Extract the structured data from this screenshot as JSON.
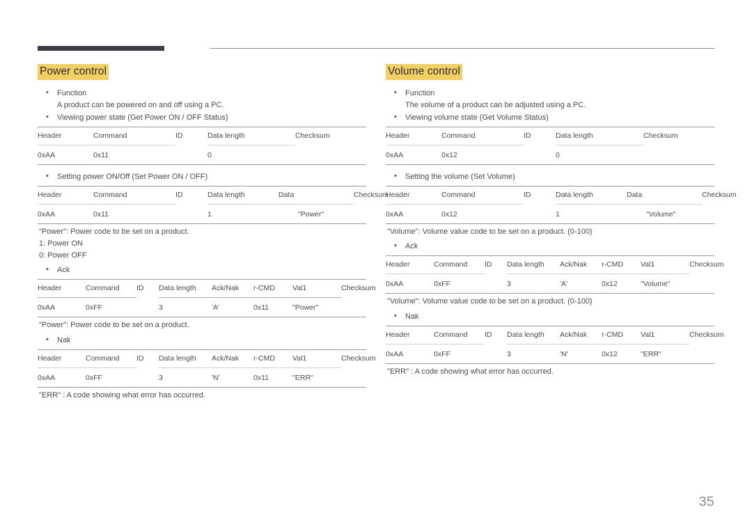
{
  "page": {
    "number": "35"
  },
  "sections": [
    {
      "id": "power-control",
      "title": "Power control",
      "function_label": "Function",
      "function_text": "A product can be powered on and off using a PC.",
      "get_label": "Viewing power state (Get Power ON / OFF Status)",
      "get_table": {
        "headers": [
          "Header",
          "Command",
          "ID",
          "Data length",
          "Checksum"
        ],
        "row": [
          "0xAA",
          "0x11",
          "",
          "0",
          ""
        ]
      },
      "set_label": "Setting power ON/Off (Set Power ON / OFF)",
      "set_table": {
        "headers": [
          "Header",
          "Command",
          "ID",
          "Data length",
          "Data",
          "Checksum"
        ],
        "row": [
          "0xAA",
          "0x11",
          "",
          "1",
          "\"Power\"",
          ""
        ]
      },
      "set_note": "\"Power\": Power code to be set on a product.",
      "set_note_lines": [
        "1: Power ON",
        "0: Power OFF"
      ],
      "ack_label": "Ack",
      "ack_table": {
        "headers": [
          "Header",
          "Command",
          "ID",
          "Data length",
          "Ack/Nak",
          "r-CMD",
          "Val1",
          "Checksum"
        ],
        "row": [
          "0xAA",
          "0xFF",
          "",
          "3",
          "'A'",
          "0x11",
          "\"Power\"",
          ""
        ]
      },
      "ack_note": "\"Power\": Power code to be set on a product.",
      "nak_label": "Nak",
      "nak_table": {
        "headers": [
          "Header",
          "Command",
          "ID",
          "Data length",
          "Ack/Nak",
          "r-CMD",
          "Val1",
          "Checksum"
        ],
        "row": [
          "0xAA",
          "0xFF",
          "",
          "3",
          "'N'",
          "0x11",
          "\"ERR\"",
          ""
        ]
      },
      "nak_note": "\"ERR\" : A code showing what error has occurred."
    },
    {
      "id": "volume-control",
      "title": "Volume control",
      "function_label": "Function",
      "function_text": "The volume of a product can be adjusted using a PC.",
      "get_label": "Viewing volume state (Get Volume Status)",
      "get_table": {
        "headers": [
          "Header",
          "Command",
          "ID",
          "Data length",
          "Checksum"
        ],
        "row": [
          "0xAA",
          "0x12",
          "",
          "0",
          ""
        ]
      },
      "set_label": "Setting the volume (Set Volume)",
      "set_table": {
        "headers": [
          "Header",
          "Command",
          "ID",
          "Data length",
          "Data",
          "Checksum"
        ],
        "row": [
          "0xAA",
          "0x12",
          "",
          "1",
          "\"Volume\"",
          ""
        ]
      },
      "set_note": "\"Volume\": Volume value code to be set on a product. (0-100)",
      "set_note_lines": [],
      "ack_label": "Ack",
      "ack_table": {
        "headers": [
          "Header",
          "Command",
          "ID",
          "Data length",
          "Ack/Nak",
          "r-CMD",
          "Val1",
          "Checksum"
        ],
        "row": [
          "0xAA",
          "0xFF",
          "",
          "3",
          "'A'",
          "0x12",
          "\"Volume\"",
          ""
        ]
      },
      "ack_note": "\"Volume\": Volume value code to be set on a product. (0-100)",
      "nak_label": "Nak",
      "nak_table": {
        "headers": [
          "Header",
          "Command",
          "ID",
          "Data length",
          "Ack/Nak",
          "r-CMD",
          "Val1",
          "Checksum"
        ],
        "row": [
          "0xAA",
          "0xFF",
          "",
          "3",
          "'N'",
          "0x12",
          "\"ERR\"",
          ""
        ]
      },
      "nak_note": "\"ERR\" : A code showing what error has occurred."
    }
  ]
}
